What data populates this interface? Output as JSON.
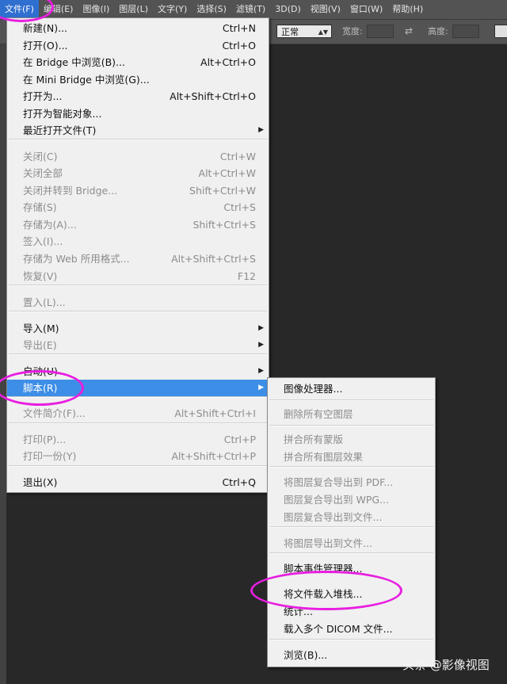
{
  "menubar": {
    "items": [
      "文件(F)",
      "编辑(E)",
      "图像(I)",
      "图层(L)",
      "文字(Y)",
      "选择(S)",
      "滤镜(T)",
      "3D(D)",
      "视图(V)",
      "窗口(W)",
      "帮助(H)"
    ]
  },
  "options": {
    "mode": "正常",
    "width_label": "宽度:",
    "height_label": "高度:"
  },
  "file_menu": {
    "items": [
      {
        "label": "新建(N)...",
        "shortcut": "Ctrl+N",
        "disabled": false
      },
      {
        "label": "打开(O)...",
        "shortcut": "Ctrl+O",
        "disabled": false
      },
      {
        "label": "在 Bridge 中浏览(B)...",
        "shortcut": "Alt+Ctrl+O",
        "disabled": false
      },
      {
        "label": "在 Mini Bridge 中浏览(G)...",
        "shortcut": "",
        "disabled": false
      },
      {
        "label": "打开为...",
        "shortcut": "Alt+Shift+Ctrl+O",
        "disabled": false
      },
      {
        "label": "打开为智能对象...",
        "shortcut": "",
        "disabled": false
      },
      {
        "label": "最近打开文件(T)",
        "shortcut": "",
        "disabled": false,
        "submenu": true
      },
      {
        "label": "关闭(C)",
        "shortcut": "Ctrl+W",
        "disabled": true
      },
      {
        "label": "关闭全部",
        "shortcut": "Alt+Ctrl+W",
        "disabled": true
      },
      {
        "label": "关闭并转到 Bridge...",
        "shortcut": "Shift+Ctrl+W",
        "disabled": true
      },
      {
        "label": "存储(S)",
        "shortcut": "Ctrl+S",
        "disabled": true
      },
      {
        "label": "存储为(A)...",
        "shortcut": "Shift+Ctrl+S",
        "disabled": true
      },
      {
        "label": "签入(I)...",
        "shortcut": "",
        "disabled": true
      },
      {
        "label": "存储为 Web 所用格式...",
        "shortcut": "Alt+Shift+Ctrl+S",
        "disabled": true
      },
      {
        "label": "恢复(V)",
        "shortcut": "F12",
        "disabled": true
      },
      {
        "label": "置入(L)...",
        "shortcut": "",
        "disabled": true
      },
      {
        "label": "导入(M)",
        "shortcut": "",
        "disabled": false,
        "submenu": true
      },
      {
        "label": "导出(E)",
        "shortcut": "",
        "disabled": true,
        "submenu": true
      },
      {
        "label": "自动(U)",
        "shortcut": "",
        "disabled": false,
        "submenu": true
      },
      {
        "label": "脚本(R)",
        "shortcut": "",
        "disabled": false,
        "submenu": true,
        "highlight": true
      },
      {
        "label": "文件简介(F)...",
        "shortcut": "Alt+Shift+Ctrl+I",
        "disabled": true
      },
      {
        "label": "打印(P)...",
        "shortcut": "Ctrl+P",
        "disabled": true
      },
      {
        "label": "打印一份(Y)",
        "shortcut": "Alt+Shift+Ctrl+P",
        "disabled": true
      },
      {
        "label": "退出(X)",
        "shortcut": "Ctrl+Q",
        "disabled": false
      }
    ]
  },
  "scripts_menu": {
    "items": [
      {
        "label": "图像处理器...",
        "disabled": false
      },
      {
        "label": "删除所有空图层",
        "disabled": true
      },
      {
        "label": "拼合所有蒙版",
        "disabled": true
      },
      {
        "label": "拼合所有图层效果",
        "disabled": true
      },
      {
        "label": "将图层复合导出到 PDF...",
        "disabled": true
      },
      {
        "label": "图层复合导出到 WPG...",
        "disabled": true
      },
      {
        "label": "图层复合导出到文件...",
        "disabled": true
      },
      {
        "label": "将图层导出到文件...",
        "disabled": true
      },
      {
        "label": "脚本事件管理器...",
        "disabled": false
      },
      {
        "label": "将文件载入堆栈...",
        "disabled": false
      },
      {
        "label": "统计...",
        "disabled": false
      },
      {
        "label": "载入多个 DICOM 文件...",
        "disabled": false
      },
      {
        "label": "浏览(B)...",
        "disabled": false
      }
    ]
  },
  "watermark": "头条 @影像视图",
  "colors": {
    "highlight": "#3d8ee6",
    "annotation": "#e81ee0"
  }
}
